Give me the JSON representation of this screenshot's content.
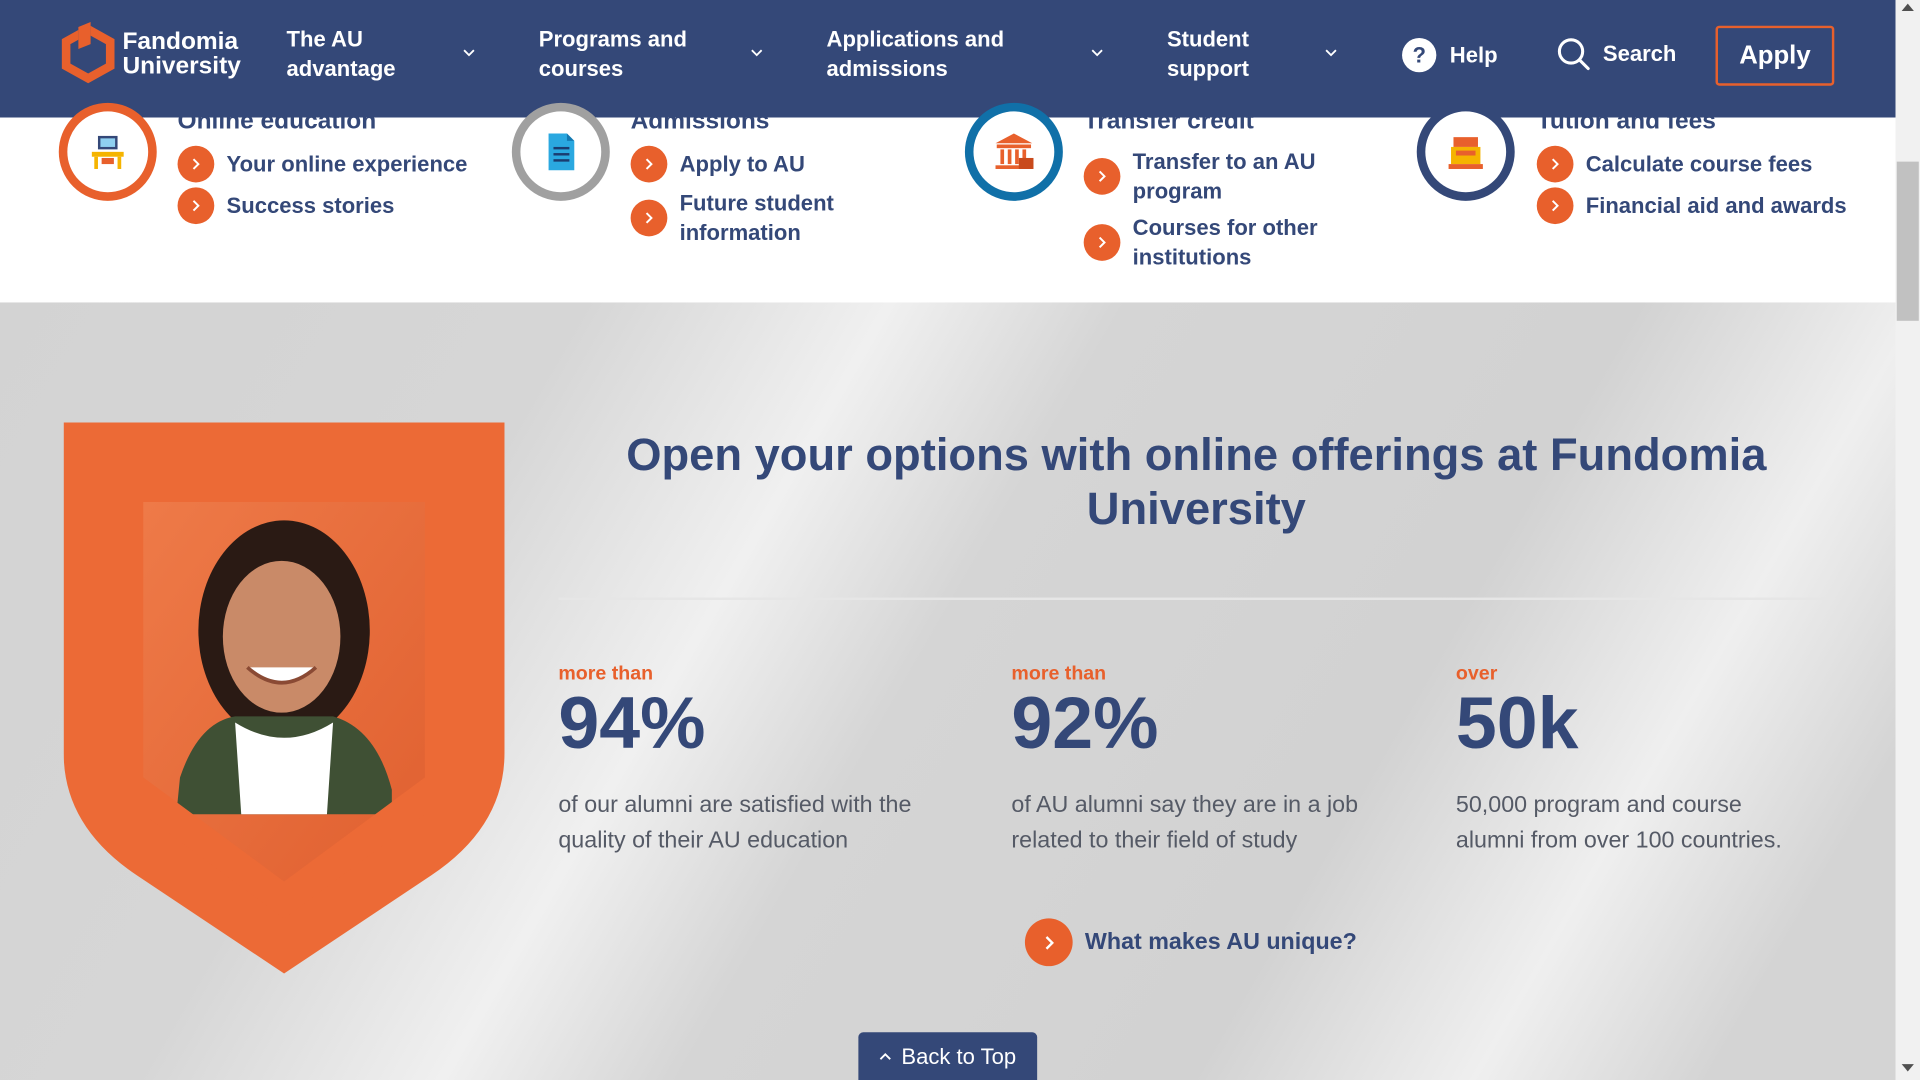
{
  "brand": {
    "name_line1": "Fandomia",
    "name_line2": "University",
    "accent": "#e8602c",
    "navy": "#344878"
  },
  "nav": {
    "items": [
      {
        "line1": "The AU",
        "line2": "advantage"
      },
      {
        "line1": "Programs and",
        "line2": "courses"
      },
      {
        "line1": "Applications and",
        "line2": "admissions"
      },
      {
        "line1": "Student",
        "line2": "support"
      }
    ],
    "help_label": "Help",
    "search_label": "Search",
    "apply_label": "Apply"
  },
  "quick_links": [
    {
      "title": "Online education",
      "icon": "computer-desk-icon",
      "links": [
        "Your online experience",
        "Success stories"
      ]
    },
    {
      "title": "Admissions",
      "icon": "document-icon",
      "links": [
        "Apply to AU",
        "Future student information"
      ]
    },
    {
      "title": "Transfer credit",
      "icon": "institution-icon",
      "links": [
        "Transfer to an AU program",
        "Courses for other institutions"
      ]
    },
    {
      "title": "Tution and fees",
      "icon": "cash-register-icon",
      "links": [
        "Calculate course fees",
        "Financial aid and awards"
      ]
    }
  ],
  "main": {
    "headline_line1": "Open your options with online offerings at Fundomia",
    "headline_line2": "University",
    "stats": [
      {
        "prefix": "more than",
        "value": "94%",
        "desc_line1": "of our alumni are satisfied with the",
        "desc_line2": "quality of their AU education"
      },
      {
        "prefix": "more than",
        "value": "92%",
        "desc_line1": "of AU alumni say they are in a job",
        "desc_line2": "related to their field of study"
      },
      {
        "prefix": "over",
        "value": "50k",
        "desc_line1": "50,000 program and course",
        "desc_line2": "alumni from over 100 countries."
      }
    ],
    "cta_label": "What makes AU unique?",
    "back_to_top": "Back to Top"
  }
}
